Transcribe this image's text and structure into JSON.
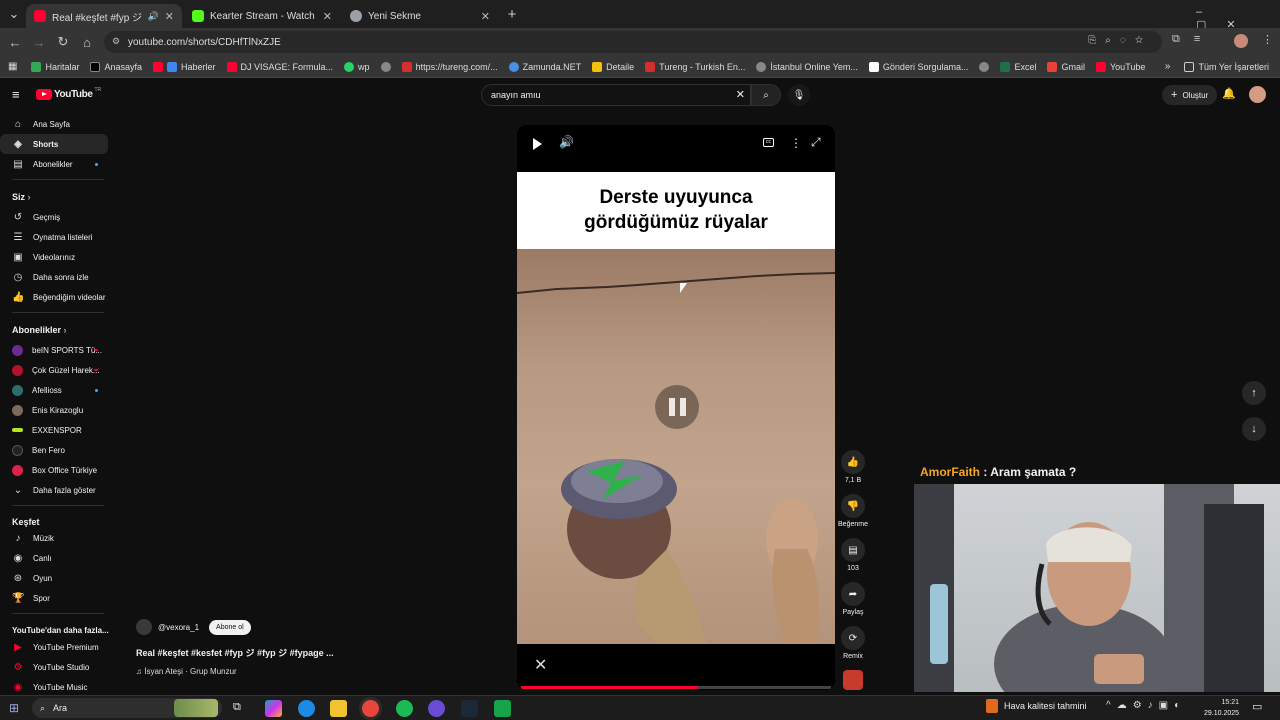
{
  "browser": {
    "tabs": [
      {
        "title": "Real #keşfet #fyp ジ",
        "active": true,
        "color": "#ff0033"
      },
      {
        "title": "Kearter Stream - Watch Live on",
        "active": false,
        "color": "#53fc18"
      },
      {
        "title": "Yeni Sekme",
        "active": false,
        "color": "#9aa0a6"
      }
    ],
    "url": "youtube.com/shorts/CDHfTlNxZJE",
    "bookmarks": [
      "Haritalar",
      "Anasayfa",
      "Haberler",
      "DJ VISAGE: Formula...",
      "wp",
      "https://tureng.com/...",
      "Zamunda.NET",
      "Detaile",
      "Tureng - Turkish En...",
      "İstanbul Online Yem...",
      "Gönderi Sorgulama...",
      "Excel",
      "Gmail",
      "YouTube"
    ],
    "all_bookmarks": "Tüm Yer İşaretleri"
  },
  "youtube": {
    "logo": "YouTube",
    "logo_sup": "TR",
    "search_value": "anayın amıu",
    "create_label": "Oluştur",
    "sidebar": {
      "main": [
        "Ana Sayfa",
        "Shorts",
        "Abonelikler"
      ],
      "you_header": "Siz",
      "you_items": [
        "Geçmiş",
        "Oynatma listeleri",
        "Videolarınız",
        "Daha sonra izle",
        "Beğendiğim videolar"
      ],
      "subs_header": "Abonelikler",
      "subs": [
        "beIN SPORTS Tü...",
        "Çok Güzel Harek...",
        "Afellioss",
        "Enis Kirazoglu",
        "EXXENSPOR",
        "Ben Fero",
        "Box Office Türkiye",
        "Daha fazla göster"
      ],
      "explore_header": "Keşfet",
      "explore": [
        "Müzik",
        "Canlı",
        "Oyun",
        "Spor"
      ],
      "more_header": "YouTube'dan daha fazla...",
      "more": [
        "YouTube Premium",
        "YouTube Studio",
        "YouTube Music"
      ]
    },
    "short": {
      "caption_line1": "Derste uyuyunca",
      "caption_line2": "gördüğümüz rüyalar",
      "channel": "@vexora_1",
      "subscribe": "Abone ol",
      "title": "Real #keşfet #kesfet #fyp ジ #fyp ジ #fypage ...",
      "music": "♫ İsyan Ateşi · Grup Munzur",
      "progress": 0.57
    },
    "actions": {
      "likes": "7,1 B",
      "dislike": "Beğenme",
      "comments": "103",
      "share": "Paylaş",
      "remix": "Remix"
    }
  },
  "stream_overlay": {
    "user": "AmorFaith",
    "message": " : Aram şamata ?"
  },
  "taskbar": {
    "search": "Ara",
    "weather": "Hava kalitesi tahmini",
    "time": "15:21",
    "date": "29.10.2025"
  }
}
